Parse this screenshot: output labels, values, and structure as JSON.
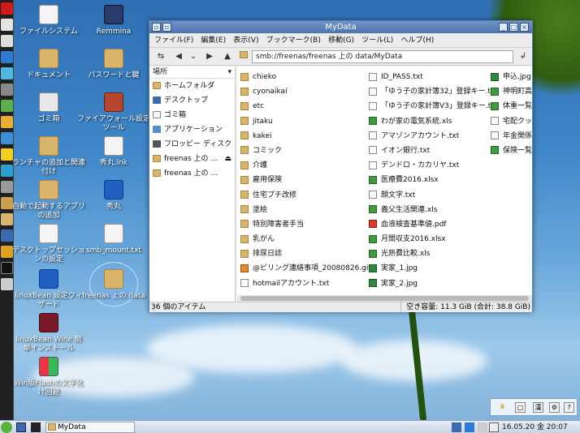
{
  "desktop": {
    "icons": [
      {
        "label": "ファイルシステム"
      },
      {
        "label": "Remmina"
      },
      {
        "label": "ドキュメント"
      },
      {
        "label": "パスワードと鍵"
      },
      {
        "label": "ゴミ箱"
      },
      {
        "label": "ファイアウォール設定ツール"
      },
      {
        "label": "ランチャの追加と関連付け"
      },
      {
        "label": "秀丸.lnk"
      },
      {
        "label": "自動で起動するアプリの追加"
      },
      {
        "label": "秀丸"
      },
      {
        "label": "デスクトップセッションの設定"
      },
      {
        "label": "smb_mount.txt"
      },
      {
        "label": "linuxBean 設定ウィザード"
      },
      {
        "label": "freenas 上の data"
      },
      {
        "label": "linuxBean Wine 簡単インストール"
      },
      {
        "label": "Win版Flashの文字化け回避"
      }
    ]
  },
  "window": {
    "title": "MyData",
    "menu": [
      "ファイル(F)",
      "編集(E)",
      "表示(V)",
      "ブックマーク(B)",
      "移動(G)",
      "ツール(L)",
      "ヘルプ(H)"
    ],
    "address": "smb://freenas/freenas 上の data/MyData",
    "sidebar_header": "場所",
    "sidebar": [
      {
        "label": "ホームフォルダ"
      },
      {
        "label": "デスクトップ"
      },
      {
        "label": "ゴミ箱"
      },
      {
        "label": "アプリケーション"
      },
      {
        "label": "フロッピー ディスク"
      },
      {
        "label": "freenas 上の …"
      },
      {
        "label": "freenas 上の …"
      }
    ],
    "files_col1": [
      {
        "name": "chieko",
        "type": "folder"
      },
      {
        "name": "cyonaikai",
        "type": "folder"
      },
      {
        "name": "etc",
        "type": "folder"
      },
      {
        "name": "jitaku",
        "type": "folder"
      },
      {
        "name": "kakei",
        "type": "folder"
      },
      {
        "name": "コミック",
        "type": "folder"
      },
      {
        "name": "介護",
        "type": "folder"
      },
      {
        "name": "雇用保険",
        "type": "folder"
      },
      {
        "name": "住宅プチ改修",
        "type": "folder"
      },
      {
        "name": "塗絵",
        "type": "folder"
      },
      {
        "name": "特別障害者手当",
        "type": "folder"
      },
      {
        "name": "乳がん",
        "type": "folder"
      },
      {
        "name": "排尿日誌",
        "type": "folder"
      },
      {
        "name": "@ピリング連絡事項_20080826.gif",
        "type": "gif"
      },
      {
        "name": "hotmailアカウント.txt",
        "type": "text"
      }
    ],
    "files_col2": [
      {
        "name": "ID_PASS.txt",
        "type": "text"
      },
      {
        "name": "「ゆう子の家計簿32」登録キー.txt",
        "type": "text"
      },
      {
        "name": "「ゆう子の家計簿V3」登録キー.txt",
        "type": "text"
      },
      {
        "name": "わが家の電気系統.xls",
        "type": "sheet"
      },
      {
        "name": "アマゾンアカウント.txt",
        "type": "text"
      },
      {
        "name": "イオン銀行.txt",
        "type": "text"
      },
      {
        "name": "デンドロ・カカリヤ.txt",
        "type": "text"
      },
      {
        "name": "医療費2016.xlsx",
        "type": "sheet"
      },
      {
        "name": "顔文字.txt",
        "type": "text"
      },
      {
        "name": "義父生活関連.xls",
        "type": "sheet"
      },
      {
        "name": "血液検査基準値.pdf",
        "type": "pdf"
      },
      {
        "name": "月間収支2016.xlsx",
        "type": "sheet"
      },
      {
        "name": "光熱費比較.xls",
        "type": "sheet"
      },
      {
        "name": "実家_1.jpg",
        "type": "image"
      },
      {
        "name": "実家_2.jpg",
        "type": "image"
      }
    ],
    "files_col3": [
      {
        "name": "申込.jpg",
        "type": "image"
      },
      {
        "name": "神明町高…",
        "type": "sheet"
      },
      {
        "name": "体重一覧…",
        "type": "sheet"
      },
      {
        "name": "宅配クック…",
        "type": "text"
      },
      {
        "name": "年金関係…",
        "type": "text"
      },
      {
        "name": "保険一覧…",
        "type": "sheet"
      }
    ],
    "status_left": "36 個のアイテム",
    "status_right": "空き容量: 11.3 GiB (合計: 38.8 GiB)"
  },
  "taskbar": {
    "task_label": "MyData",
    "clock": "16.05.20 金 20:07"
  }
}
